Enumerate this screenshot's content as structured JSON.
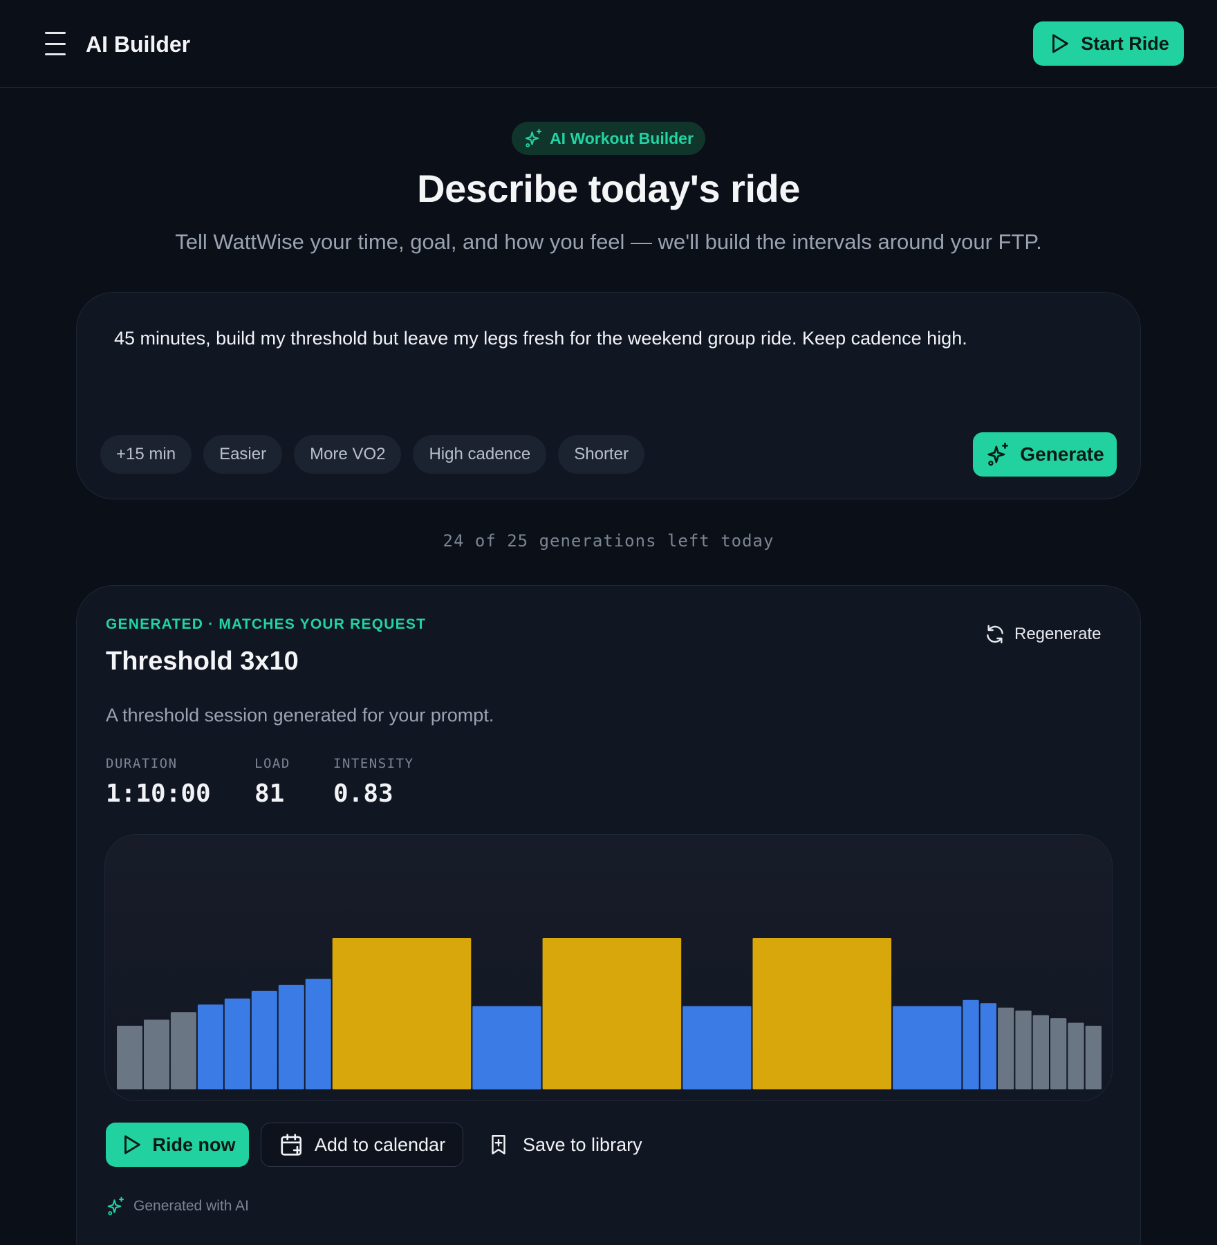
{
  "header": {
    "title": "AI Builder",
    "start_ride_label": "Start Ride"
  },
  "hero": {
    "pill_label": "AI Workout Builder",
    "title": "Describe today's ride",
    "subtitle": "Tell WattWise your time, goal, and how you feel — we'll build the intervals around your FTP."
  },
  "prompt": {
    "text": "45 minutes, build my threshold but leave my legs fresh for the weekend group ride. Keep cadence high.",
    "chips": [
      "+15 min",
      "Easier",
      "More VO2",
      "High cadence",
      "Shorter"
    ],
    "generate_label": "Generate"
  },
  "generations_left": "24 of 25 generations left today",
  "result": {
    "kicker": "GENERATED · MATCHES YOUR REQUEST",
    "title": "Threshold 3x10",
    "regenerate_label": "Regenerate",
    "description": "A threshold session generated for your prompt.",
    "stats": [
      {
        "label": "DURATION",
        "value": "1:10:00"
      },
      {
        "label": "LOAD",
        "value": "81"
      },
      {
        "label": "INTENSITY",
        "value": "0.83"
      }
    ],
    "actions": {
      "ride_now": "Ride now",
      "add_to_calendar": "Add to calendar",
      "save_to_library": "Save to library"
    },
    "footer": "Generated with AI"
  },
  "colors": {
    "accent": "#21d1a0",
    "zone_recovery": "#6b7685",
    "zone_endurance": "#3b7be6",
    "zone_threshold": "#d8a70c"
  },
  "chart_data": {
    "type": "bar",
    "description_of_units": "relative intensity per interval segment, segment duration relative",
    "segments": [
      {
        "zone": "recovery",
        "duration": 1,
        "intensity": 0.42
      },
      {
        "zone": "recovery",
        "duration": 1,
        "intensity": 0.46
      },
      {
        "zone": "recovery",
        "duration": 1,
        "intensity": 0.51
      },
      {
        "zone": "endurance",
        "duration": 1,
        "intensity": 0.56
      },
      {
        "zone": "endurance",
        "duration": 1,
        "intensity": 0.6
      },
      {
        "zone": "endurance",
        "duration": 1,
        "intensity": 0.65
      },
      {
        "zone": "endurance",
        "duration": 1,
        "intensity": 0.69
      },
      {
        "zone": "endurance",
        "duration": 1,
        "intensity": 0.73
      },
      {
        "zone": "threshold",
        "duration": 5.2,
        "intensity": 1.0
      },
      {
        "zone": "endurance",
        "duration": 2.6,
        "intensity": 0.55
      },
      {
        "zone": "threshold",
        "duration": 5.2,
        "intensity": 1.0
      },
      {
        "zone": "endurance",
        "duration": 2.6,
        "intensity": 0.55
      },
      {
        "zone": "threshold",
        "duration": 5.2,
        "intensity": 1.0
      },
      {
        "zone": "endurance",
        "duration": 2.6,
        "intensity": 0.55
      },
      {
        "zone": "endurance",
        "duration": 0.65,
        "intensity": 0.59
      },
      {
        "zone": "endurance",
        "duration": 0.65,
        "intensity": 0.57
      },
      {
        "zone": "recovery",
        "duration": 0.65,
        "intensity": 0.54
      },
      {
        "zone": "recovery",
        "duration": 0.65,
        "intensity": 0.52
      },
      {
        "zone": "recovery",
        "duration": 0.65,
        "intensity": 0.49
      },
      {
        "zone": "recovery",
        "duration": 0.65,
        "intensity": 0.47
      },
      {
        "zone": "recovery",
        "duration": 0.65,
        "intensity": 0.44
      },
      {
        "zone": "recovery",
        "duration": 0.65,
        "intensity": 0.42
      }
    ]
  }
}
